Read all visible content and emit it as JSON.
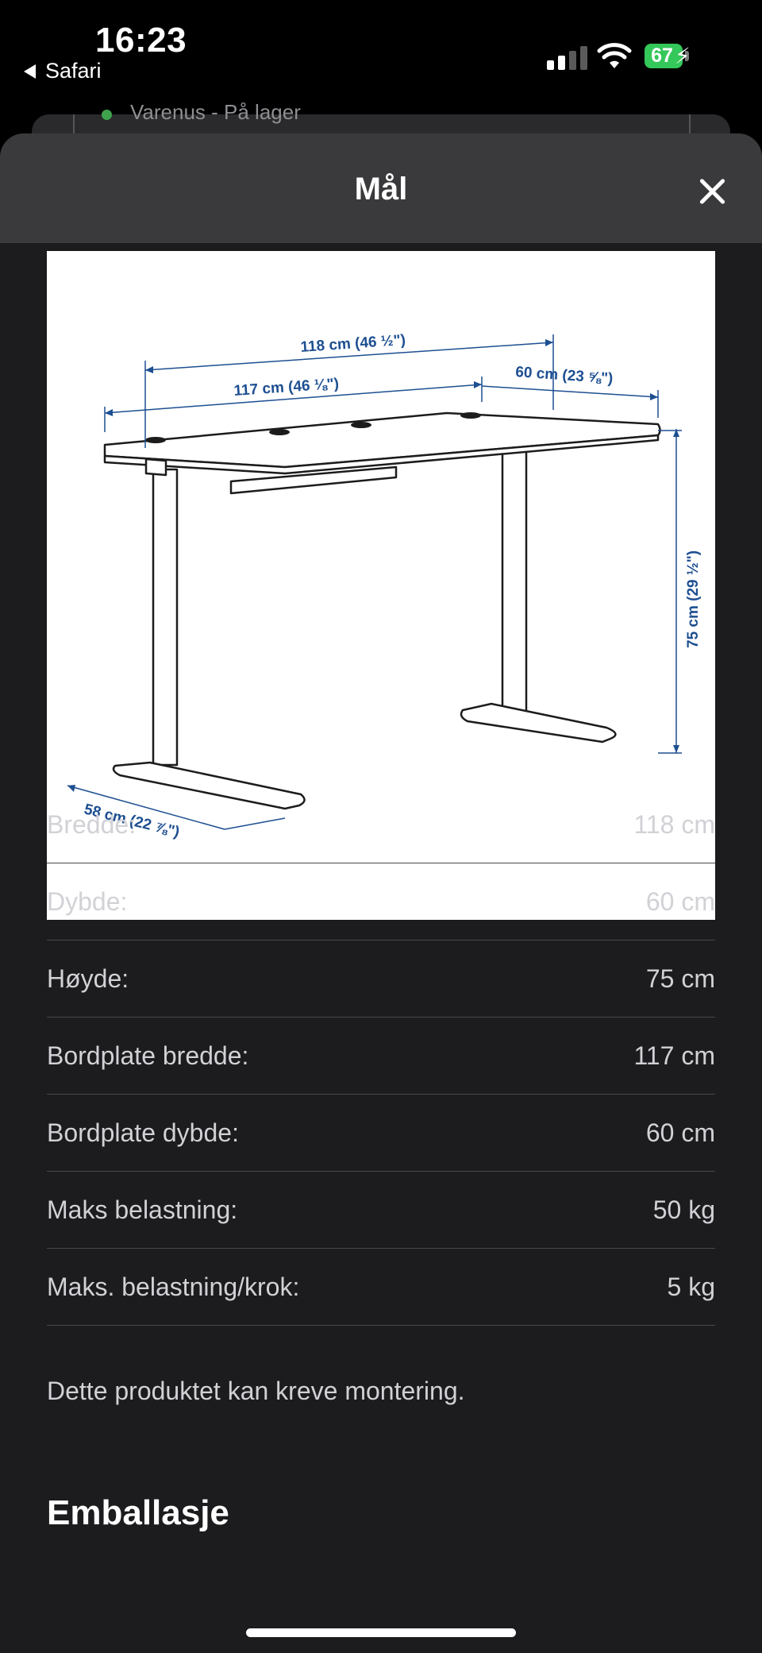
{
  "status_bar": {
    "time": "16:23",
    "back_app": "Safari",
    "battery": "67"
  },
  "background": {
    "availability_text": "Varenus - På lager"
  },
  "sheet": {
    "title": "Mål",
    "close_icon": "close-icon"
  },
  "diagram": {
    "labels": {
      "width_total": "118 cm (46 ½\")",
      "width_top": "117 cm (46 ⅛\")",
      "depth_top": "60 cm (23 ⅝\")",
      "height": "75 cm (29 ½\")",
      "foot_depth": "58 cm (22 ⅞\")"
    }
  },
  "specs": [
    {
      "label": "Bredde:",
      "value": "118 cm"
    },
    {
      "label": "Dybde:",
      "value": "60 cm"
    },
    {
      "label": "Høyde:",
      "value": "75 cm"
    },
    {
      "label": "Bordplate bredde:",
      "value": "117 cm"
    },
    {
      "label": "Bordplate dybde:",
      "value": "60 cm"
    },
    {
      "label": "Maks belastning:",
      "value": "50 kg"
    },
    {
      "label": "Maks. belastning/krok:",
      "value": "5 kg"
    }
  ],
  "note": "Dette produktet kan kreve montering.",
  "next_section": "Emballasje"
}
